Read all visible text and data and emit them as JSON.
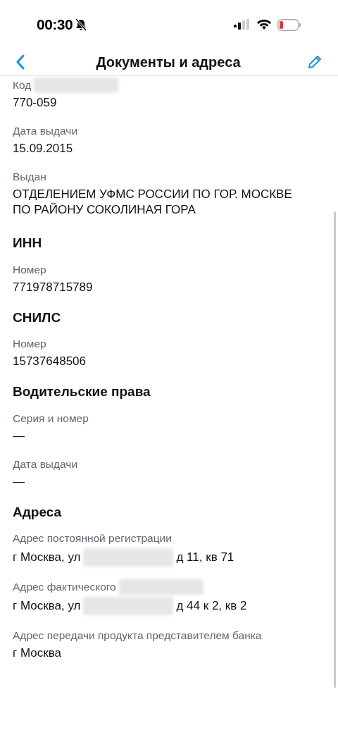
{
  "status_bar": {
    "time": "00:30"
  },
  "header": {
    "title": "Документы и адреса"
  },
  "sections": [
    {
      "fields": [
        {
          "label": [
            {
              "kind": "text",
              "text": "Код"
            },
            {
              "kind": "redacted"
            }
          ],
          "value": [
            {
              "kind": "text",
              "text": "770-059"
            }
          ]
        },
        {
          "label": [
            {
              "kind": "text",
              "text": "Дата выдачи"
            }
          ],
          "value": [
            {
              "kind": "text",
              "text": "15.09.2015"
            }
          ]
        },
        {
          "label": [
            {
              "kind": "text",
              "text": "Выдан"
            }
          ],
          "value": [
            {
              "kind": "text",
              "text": "ОТДЕЛЕНИЕМ УФМС РОССИИ ПО ГОР. МОСКВЕ ПО РАЙОНУ СОКОЛИНАЯ ГОРА"
            }
          ]
        }
      ]
    },
    {
      "title": "ИНН",
      "fields": [
        {
          "label": [
            {
              "kind": "text",
              "text": "Номер"
            }
          ],
          "value": [
            {
              "kind": "text",
              "text": "771978715789"
            }
          ]
        }
      ]
    },
    {
      "title": "СНИЛС",
      "fields": [
        {
          "label": [
            {
              "kind": "text",
              "text": "Номер"
            }
          ],
          "value": [
            {
              "kind": "text",
              "text": "15737648506"
            }
          ]
        }
      ]
    },
    {
      "title": "Водительские права",
      "fields": [
        {
          "label": [
            {
              "kind": "text",
              "text": "Серия и номер"
            }
          ],
          "value": [
            {
              "kind": "text",
              "text": "—"
            }
          ]
        },
        {
          "label": [
            {
              "kind": "text",
              "text": "Дата выдачи"
            }
          ],
          "value": [
            {
              "kind": "text",
              "text": "—"
            }
          ]
        }
      ]
    },
    {
      "title": "Адреса",
      "fields": [
        {
          "label": [
            {
              "kind": "text",
              "text": "Адрес постоянной регистрации"
            }
          ],
          "value": [
            {
              "kind": "text",
              "text": "г Москва, ул"
            },
            {
              "kind": "redacted"
            },
            {
              "kind": "text",
              "text": "д 11, кв 71"
            }
          ]
        },
        {
          "label": [
            {
              "kind": "text",
              "text": "Адрес фактического"
            },
            {
              "kind": "redacted"
            }
          ],
          "value": [
            {
              "kind": "text",
              "text": "г Москва, ул"
            },
            {
              "kind": "redacted"
            },
            {
              "kind": "text",
              "text": "д 44 к 2, кв 2"
            }
          ]
        },
        {
          "label": [
            {
              "kind": "text",
              "text": "Адрес передачи продукта представителем банка"
            }
          ],
          "value": [
            {
              "kind": "text",
              "text": "г Москва"
            }
          ]
        }
      ]
    }
  ]
}
